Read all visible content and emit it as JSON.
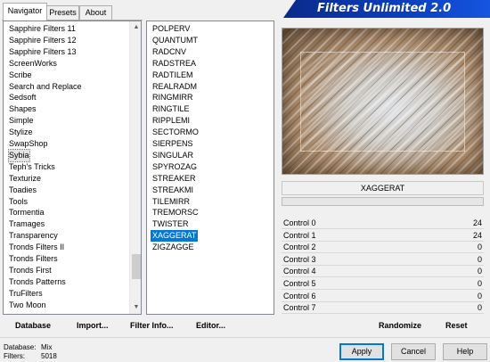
{
  "tabs": [
    "Navigator",
    "Presets",
    "About"
  ],
  "app_title": "Filters Unlimited 2.0",
  "categories": [
    "Sapphire Filters 11",
    "Sapphire Filters 12",
    "Sapphire Filters 13",
    "ScreenWorks",
    "Scribe",
    "Search and Replace",
    "Sedsoft",
    "Shapes",
    "Simple",
    "Stylize",
    "SwapShop",
    "Sybia",
    "Teph's Tricks",
    "Texturize",
    "Toadies",
    "Tools",
    "Tormentia",
    "Tramages",
    "Transparency",
    "Tronds Filters II",
    "Tronds Filters",
    "Tronds First",
    "Tronds Patterns",
    "TruFilters",
    "Two Moon"
  ],
  "selected_category": "Sybia",
  "filters": [
    "POLPERV",
    "QUANTUMT",
    "RADCNV",
    "RADSTREA",
    "RADTILEM",
    "REALRADM",
    "RINGMIRR",
    "RINGTILE",
    "RIPPLEMI",
    "SECTORMO",
    "SIERPENS",
    "SINGULAR",
    "SPYROZAG",
    "STREAKER",
    "STREAKMI",
    "TILEMIRR",
    "TREMORSC",
    "TWISTER",
    "XAGGERAT",
    "ZIGZAGGE"
  ],
  "selected_filter": "XAGGERAT",
  "filter_name": "XAGGERAT",
  "controls": [
    {
      "label": "Control 0",
      "value": "24"
    },
    {
      "label": "Control 1",
      "value": "24"
    },
    {
      "label": "Control 2",
      "value": "0"
    },
    {
      "label": "Control 3",
      "value": "0"
    },
    {
      "label": "Control 4",
      "value": "0"
    },
    {
      "label": "Control 5",
      "value": "0"
    },
    {
      "label": "Control 6",
      "value": "0"
    },
    {
      "label": "Control 7",
      "value": "0"
    }
  ],
  "actions": {
    "database": "Database",
    "import": "Import...",
    "filter_info": "Filter Info...",
    "editor": "Editor...",
    "randomize": "Randomize",
    "reset": "Reset"
  },
  "info": {
    "database_label": "Database:",
    "database_value": "Mix",
    "filters_label": "Filters:",
    "filters_value": "5018"
  },
  "buttons": {
    "apply": "Apply",
    "cancel": "Cancel",
    "help": "Help"
  },
  "colors": {
    "selection": "#0078d7",
    "banner": "#0b3fc0"
  }
}
